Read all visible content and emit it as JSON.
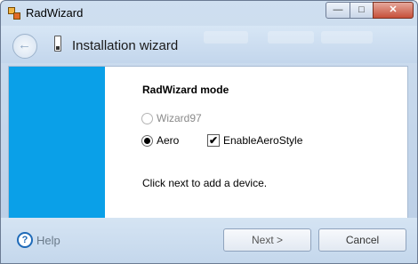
{
  "window": {
    "title": "RadWizard"
  },
  "title_buttons": {
    "minimize": "—",
    "maximize": "□",
    "close": "✕"
  },
  "header": {
    "title": "Installation wizard",
    "back_icon": "arrow-left-icon",
    "page_icon": "device-icon"
  },
  "content": {
    "mode_title": "RadWizard mode",
    "options": {
      "wizard97": {
        "label": "Wizard97",
        "selected": false,
        "enabled": false
      },
      "aero": {
        "label": "Aero",
        "selected": true,
        "enabled": true
      }
    },
    "checkbox": {
      "label": "EnableAeroStyle",
      "checked": true,
      "mark": "✔"
    },
    "message": "Click next to add a device."
  },
  "footer": {
    "help_label": "Help",
    "help_icon": "?",
    "next_label": "Next  >",
    "cancel_label": "Cancel"
  },
  "colors": {
    "accent_panel": "#0aa0e8",
    "help_icon": "#1e6ab8"
  }
}
